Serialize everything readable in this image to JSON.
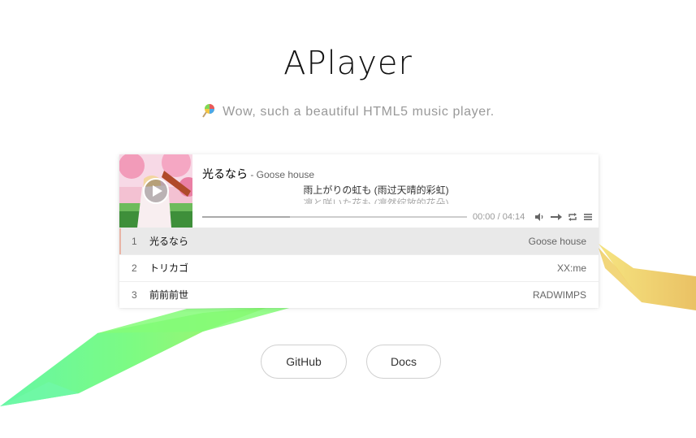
{
  "header": {
    "title": "APlayer",
    "subtitle": "Wow, such a beautiful HTML5 music player."
  },
  "player": {
    "current": {
      "title": "光るなら",
      "artist_sep": " - ",
      "artist": "Goose house",
      "lyric_current": "雨上がりの虹も (雨过天晴的彩虹)",
      "lyric_next": "凛と咲いた花も (凛然绽放的花朵)"
    },
    "time": "00:00 / 04:14",
    "progress_played": 0,
    "progress_loaded": 0.33,
    "icons": [
      "play-icon",
      "volume-icon",
      "order-icon",
      "loop-icon",
      "menu-icon"
    ],
    "playlist": [
      {
        "index": "1",
        "title": "光るなら",
        "artist": "Goose house"
      },
      {
        "index": "2",
        "title": "トリカゴ",
        "artist": "XX:me"
      },
      {
        "index": "3",
        "title": "前前前世",
        "artist": "RADWIMPS"
      }
    ]
  },
  "links": {
    "github": "GitHub",
    "docs": "Docs"
  },
  "colors": {
    "accent_bar": "#e8b4a6",
    "active_row": "#e9e9e9",
    "ribbon_green": "#6dfb8c",
    "ribbon_yellow": "#e8c05a"
  }
}
